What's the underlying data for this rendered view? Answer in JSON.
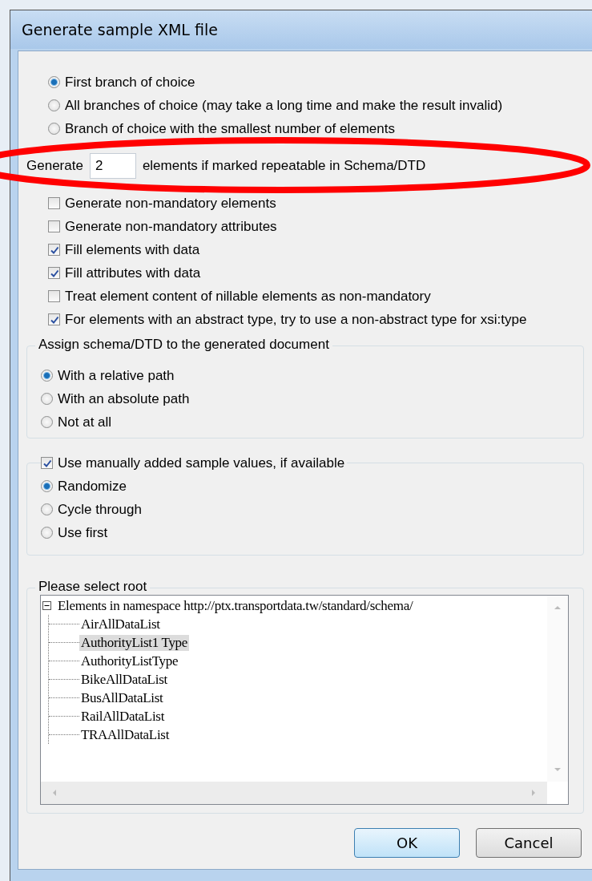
{
  "window": {
    "title": "Generate sample XML file"
  },
  "choice_options": [
    {
      "label": "First branch of choice",
      "selected": true
    },
    {
      "label": "All branches of choice (may take a long time and make the result invalid)",
      "selected": false
    },
    {
      "label": "Branch of choice with the smallest number of elements",
      "selected": false
    }
  ],
  "repeat": {
    "prefix": "Generate",
    "value": "2",
    "suffix": "elements if marked repeatable in Schema/DTD"
  },
  "options": [
    {
      "label": "Generate non-mandatory elements",
      "checked": false
    },
    {
      "label": "Generate non-mandatory attributes",
      "checked": false
    },
    {
      "label": "Fill elements with data",
      "checked": true
    },
    {
      "label": "Fill attributes with data",
      "checked": true
    },
    {
      "label": "Treat element content of nillable elements as non-mandatory",
      "checked": false
    },
    {
      "label": "For elements with an abstract type, try to use a non-abstract type for xsi:type",
      "checked": true
    }
  ],
  "assign_schema": {
    "title": "Assign schema/DTD to the generated document",
    "options": [
      {
        "label": "With a relative path",
        "selected": true
      },
      {
        "label": "With an absolute path",
        "selected": false
      },
      {
        "label": "Not at all",
        "selected": false
      }
    ]
  },
  "sample_values": {
    "label": "Use manually added sample values, if available",
    "checked": true,
    "options": [
      {
        "label": "Randomize",
        "selected": true
      },
      {
        "label": "Cycle through",
        "selected": false
      },
      {
        "label": "Use first",
        "selected": false
      }
    ]
  },
  "root": {
    "title": "Please select root",
    "tree": [
      {
        "label": "Elements in namespace http://ptx.transportdata.tw/standard/schema/",
        "expanded": true,
        "children": [
          {
            "label": "AirAllDataList",
            "selected": false
          },
          {
            "label": "AuthorityList1 Type",
            "selected": true
          },
          {
            "label": "AuthorityListType",
            "selected": false
          },
          {
            "label": "BikeAllDataList",
            "selected": false
          },
          {
            "label": "BusAllDataList",
            "selected": false
          },
          {
            "label": "RailAllDataList",
            "selected": false
          },
          {
            "label": "TRAAllDataList",
            "selected": false
          }
        ]
      }
    ]
  },
  "buttons": [
    {
      "label": "OK",
      "default": true
    },
    {
      "label": "Cancel",
      "default": false
    }
  ],
  "annotation": {
    "kind": "ellipse"
  }
}
